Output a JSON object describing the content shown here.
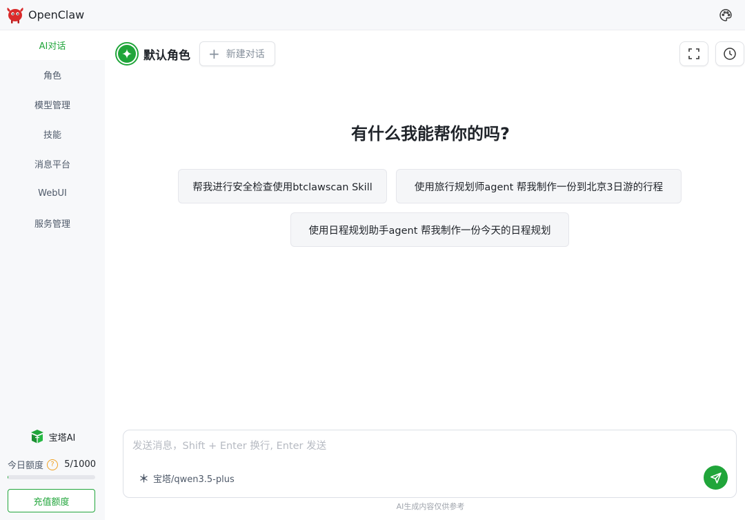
{
  "app": {
    "name": "OpenClaw"
  },
  "icons": {
    "logo": "openclaw-crab-logo",
    "theme": "palette-icon",
    "fullscreen": "fullscreen-icon",
    "history": "clock-icon",
    "role": "sparkle-icon",
    "model": "model-icon",
    "send": "send-icon",
    "baota": "baota-logo"
  },
  "colors": {
    "accent": "#20a53a",
    "warning": "#f0a020",
    "logo": "#d92b2b"
  },
  "sidebar": {
    "items": [
      {
        "label": "AI对话",
        "active": true
      },
      {
        "label": "角色",
        "active": false
      },
      {
        "label": "模型管理",
        "active": false
      },
      {
        "label": "技能",
        "active": false
      },
      {
        "label": "消息平台",
        "active": false
      },
      {
        "label": "WebUI",
        "active": false
      },
      {
        "label": "服务管理",
        "active": false
      }
    ],
    "brand": "宝塔AI",
    "quota": {
      "label": "今日额度",
      "help": "?",
      "used": 5,
      "total": 1000,
      "text": "5/1000"
    },
    "recharge_label": "充值额度"
  },
  "header": {
    "role_name": "默认角色",
    "new_chat_label": "新建对话"
  },
  "main": {
    "title": "有什么我能帮你的吗?",
    "suggestions": [
      "帮我进行安全检查使用btclawscan Skill",
      "使用旅行规划师agent 帮我制作一份到北京3日游的行程",
      "使用日程规划助手agent 帮我制作一份今天的日程规划"
    ]
  },
  "composer": {
    "value": "",
    "placeholder": "发送消息，Shift + Enter 换行, Enter 发送",
    "model": "宝塔/qwen3.5-plus"
  },
  "footer": {
    "note": "AI生成内容仅供参考"
  }
}
